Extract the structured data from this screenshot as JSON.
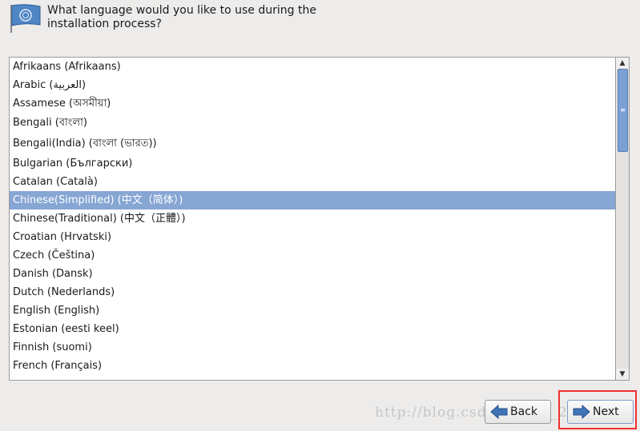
{
  "header": {
    "prompt": "What language would you like to use during the installation process?",
    "icon": "flag-icon"
  },
  "languages": [
    "Afrikaans (Afrikaans)",
    "Arabic (العربية)",
    "Assamese (অসমীয়া)",
    "Bengali (বাংলা)",
    "Bengali(India) (বাংলা (ভারত))",
    "Bulgarian (Български)",
    "Catalan (Català)",
    "Chinese(Simplified) (中文（简体）)",
    "Chinese(Traditional) (中文（正體）)",
    "Croatian (Hrvatski)",
    "Czech (Čeština)",
    "Danish (Dansk)",
    "Dutch (Nederlands)",
    "English (English)",
    "Estonian (eesti keel)",
    "Finnish (suomi)",
    "French (Français)"
  ],
  "selected_index": 7,
  "scroll_position": 0.0,
  "buttons": {
    "back": "Back",
    "next": "Next"
  },
  "watermark": "http://blog.csdn.net/qq_25110851",
  "colors": {
    "selection": "#86a6d4",
    "highlight_box": "#f03030"
  }
}
